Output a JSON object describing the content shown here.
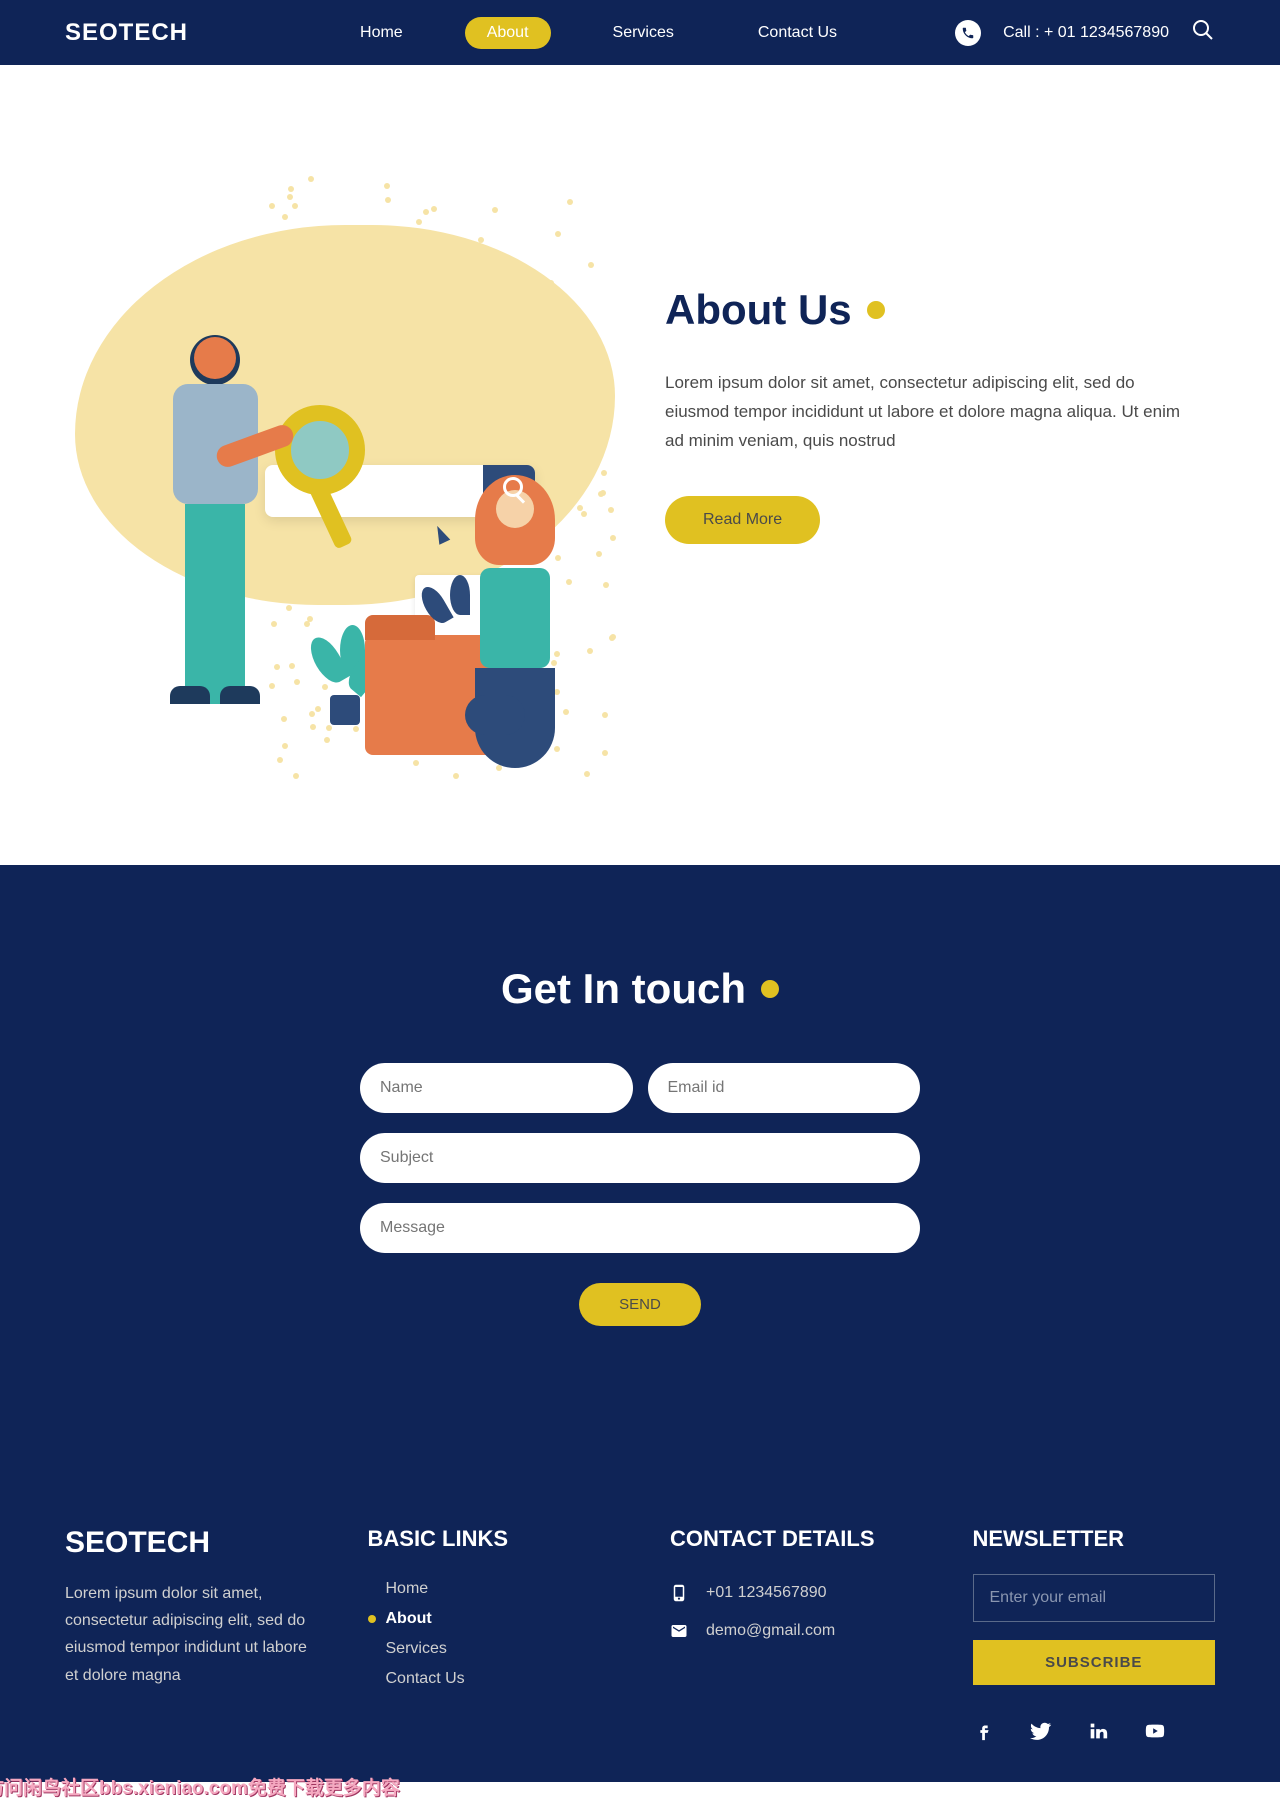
{
  "brand": "SEOTECH",
  "nav": {
    "items": [
      {
        "label": "Home",
        "active": false
      },
      {
        "label": "About",
        "active": true
      },
      {
        "label": "Services",
        "active": false
      },
      {
        "label": "Contact Us",
        "active": false
      }
    ],
    "call_label": "Call : + 01 1234567890"
  },
  "about": {
    "title": "About Us",
    "body": "Lorem ipsum dolor sit amet, consectetur adipiscing elit, sed do eiusmod tempor incididunt ut labore et dolore magna aliqua. Ut enim ad minim veniam, quis nostrud",
    "button": "Read More"
  },
  "contact": {
    "title": "Get In touch",
    "placeholders": {
      "name": "Name",
      "email": "Email id",
      "subject": "Subject",
      "message": "Message"
    },
    "send": "SEND"
  },
  "footer": {
    "brand": "SEOTECH",
    "desc": "Lorem ipsum dolor sit amet, consectetur adipiscing elit, sed do eiusmod tempor indidunt ut labore et dolore magna",
    "links_title": "BASIC LINKS",
    "links": [
      {
        "label": "Home",
        "active": false
      },
      {
        "label": "About",
        "active": true
      },
      {
        "label": "Services",
        "active": false
      },
      {
        "label": "Contact Us",
        "active": false
      }
    ],
    "contact_title": "CONTACT DETAILS",
    "phone": "+01 1234567890",
    "email": "demo@gmail.com",
    "news_title": "NEWSLETTER",
    "news_placeholder": "Enter your email",
    "subscribe": "SUBSCRIBE",
    "watermark": "访问闲鸟社区bbs.xieniao.com免费下载更多内容"
  }
}
